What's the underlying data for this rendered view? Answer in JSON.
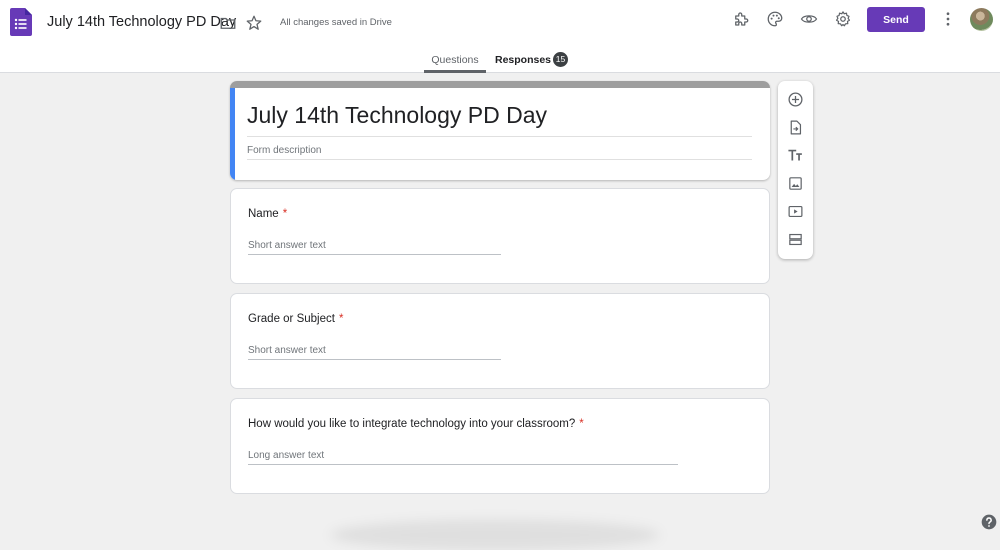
{
  "header": {
    "doc_title": "July 14th Technology PD Day",
    "save_status": "All changes saved in Drive",
    "send_label": "Send"
  },
  "tabs": {
    "questions": "Questions",
    "responses": "Responses",
    "responses_count": "15"
  },
  "form": {
    "title": "July 14th Technology PD Day",
    "description_placeholder": "Form description"
  },
  "questions": [
    {
      "title": "Name",
      "required_mark": "*",
      "answer_placeholder": "Short answer text"
    },
    {
      "title": "Grade or Subject",
      "required_mark": "*",
      "answer_placeholder": "Short answer text"
    },
    {
      "title": "How would you like to integrate technology into your classroom?",
      "required_mark": "*",
      "answer_placeholder": "Long answer text"
    }
  ],
  "colors": {
    "accent": "#673ab7",
    "title_bar": "#9e9e9e",
    "focus_bar": "#4285f4",
    "required": "#d93025"
  },
  "icons": {
    "app": "forms-icon",
    "folder": "folder-icon",
    "star": "star-icon",
    "addons": "puzzle-icon",
    "palette": "palette-icon",
    "preview": "eye-icon",
    "settings": "gear-icon",
    "more": "more-vert-icon",
    "add_question": "add-circle-icon",
    "import": "import-icon",
    "add_title": "title-icon",
    "add_image": "image-icon",
    "add_video": "video-icon",
    "add_section": "section-icon",
    "help": "help-icon"
  }
}
